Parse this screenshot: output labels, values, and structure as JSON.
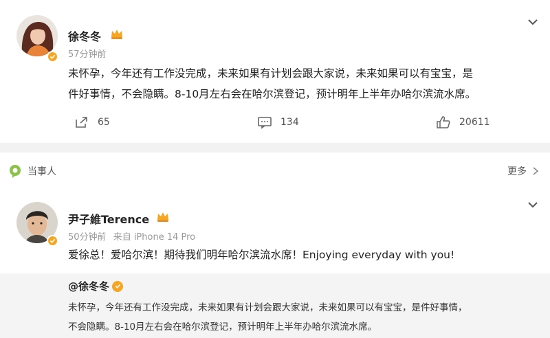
{
  "post1": {
    "author": "徐冬冬",
    "time": "57分钟前",
    "text_line1": "未怀孕，今年还有工作没完成，未来如果有计划会跟大家说，未来如果可以有宝宝，是",
    "text_line2": "件好事情，不会隐瞒。8-10月左右会在哈尔滨登记，预计明年上半年办哈尔滨流水席。",
    "reposts": "65",
    "comments": "134",
    "likes": "20611"
  },
  "section": {
    "label": "当事人",
    "more": "更多"
  },
  "post2": {
    "author": "尹子維Terence",
    "time": "50分钟前",
    "source": "来自 iPhone 14 Pro",
    "text": "爱徐总！爱哈尔滨！期待我们明年哈尔滨流水席！Enjoying everyday with you!",
    "quote_author": "@徐冬冬",
    "quote_line1": "未怀孕，今年还有工作没完成，未来如果有计划会跟大家说，未来如果可以有宝宝，是件好事情，",
    "quote_line2": "不会隐瞒。8-10月左右会在哈尔滨登记，预计明年上半年办哈尔滨流水席。"
  },
  "colors": {
    "accent_orange": "#f5a623",
    "section_green": "#8bc34a",
    "separator": "#f2f2f2"
  }
}
